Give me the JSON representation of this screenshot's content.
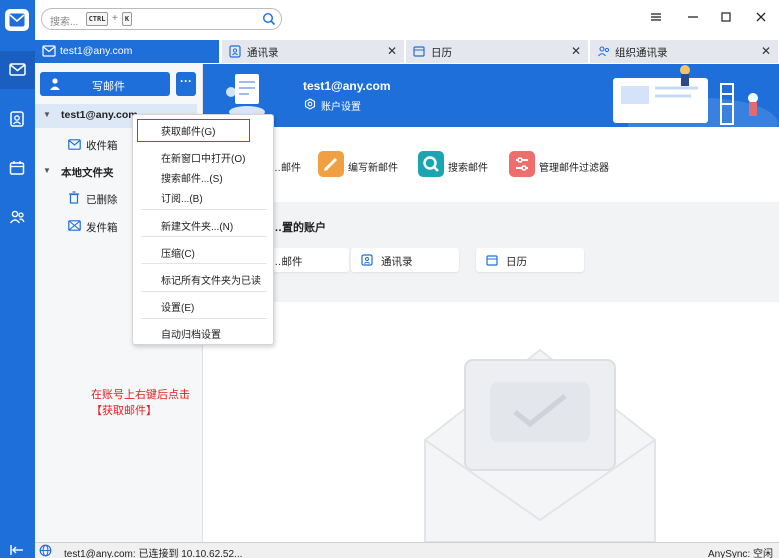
{
  "search": {
    "placeholder": "搜索...",
    "key1": "CTRL",
    "plus": "+",
    "key2": "K"
  },
  "tabs": [
    {
      "label": "test1@any.com"
    },
    {
      "label": "通讯录"
    },
    {
      "label": "日历"
    },
    {
      "label": "组织通讯录"
    }
  ],
  "left": {
    "compose_label": "写邮件",
    "more_label": "···",
    "account": "test1@any.com",
    "inbox": "收件箱",
    "local_folders": "本地文件夹",
    "deleted": "已删除",
    "sent": "发件箱"
  },
  "banner": {
    "email": "test1@any.com",
    "settings": "账户设置"
  },
  "actions": [
    "…邮件",
    "编写新邮件",
    "搜索邮件",
    "管理邮件过滤器"
  ],
  "setup": {
    "heading": "…置的账户",
    "cards": [
      "…邮件",
      "通讯录",
      "日历"
    ]
  },
  "context_menu": [
    "获取邮件(G)",
    "在新窗口中打开(O)",
    "搜索邮件...(S)",
    "订阅...(B)",
    "新建文件夹...(N)",
    "压缩(C)",
    "标记所有文件夹为已读",
    "设置(E)",
    "自动归档设置"
  ],
  "note": "在账号上右键后点击【获取邮件】",
  "status": {
    "text": "test1@any.com: 已连接到 10.10.62.52...",
    "right": "AnySync: 空闲"
  },
  "colors": {
    "brand": "#1e6fd9",
    "highlight": "#d03030",
    "note": "#e02020"
  }
}
